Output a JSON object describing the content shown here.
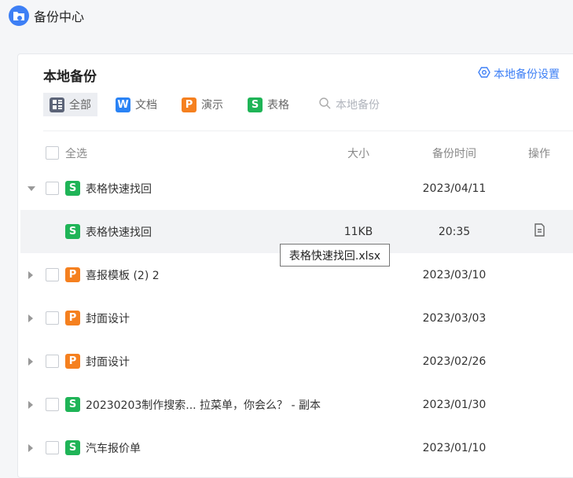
{
  "app": {
    "title": "备份中心"
  },
  "panel": {
    "title": "本地备份",
    "settings": "本地备份设置"
  },
  "tabs": [
    {
      "label": "全部",
      "icon": "grid-icon"
    },
    {
      "label": "文档",
      "icon": "W"
    },
    {
      "label": "演示",
      "icon": "P"
    },
    {
      "label": "表格",
      "icon": "S"
    }
  ],
  "search": {
    "placeholder": "本地备份"
  },
  "table": {
    "select_all": "全选",
    "col_size": "大小",
    "col_time": "备份时间",
    "col_action": "操作"
  },
  "rows": [
    {
      "name": "表格快速找回",
      "type": "S",
      "date": "2023/04/11",
      "expanded": true
    },
    {
      "name": "表格快速找回",
      "type": "S",
      "size": "11KB",
      "time": "20:35",
      "child": true
    },
    {
      "name": "喜报模板 (2) 2",
      "type": "P",
      "date": "2023/03/10"
    },
    {
      "name": "封面设计",
      "type": "P",
      "date": "2023/03/03"
    },
    {
      "name": "封面设计",
      "type": "P",
      "date": "2023/02/26"
    },
    {
      "name": "20230203制作搜索...  拉菜单，你会么？ - 副本",
      "type": "S",
      "date": "2023/01/30"
    },
    {
      "name": "汽车报价单",
      "type": "S",
      "date": "2023/01/10"
    }
  ],
  "tooltip": "表格快速找回.xlsx",
  "colors": {
    "accent": "#3d7ff5",
    "sheet": "#1fb457",
    "ppt": "#f5801f",
    "doc": "#2a83f5"
  }
}
